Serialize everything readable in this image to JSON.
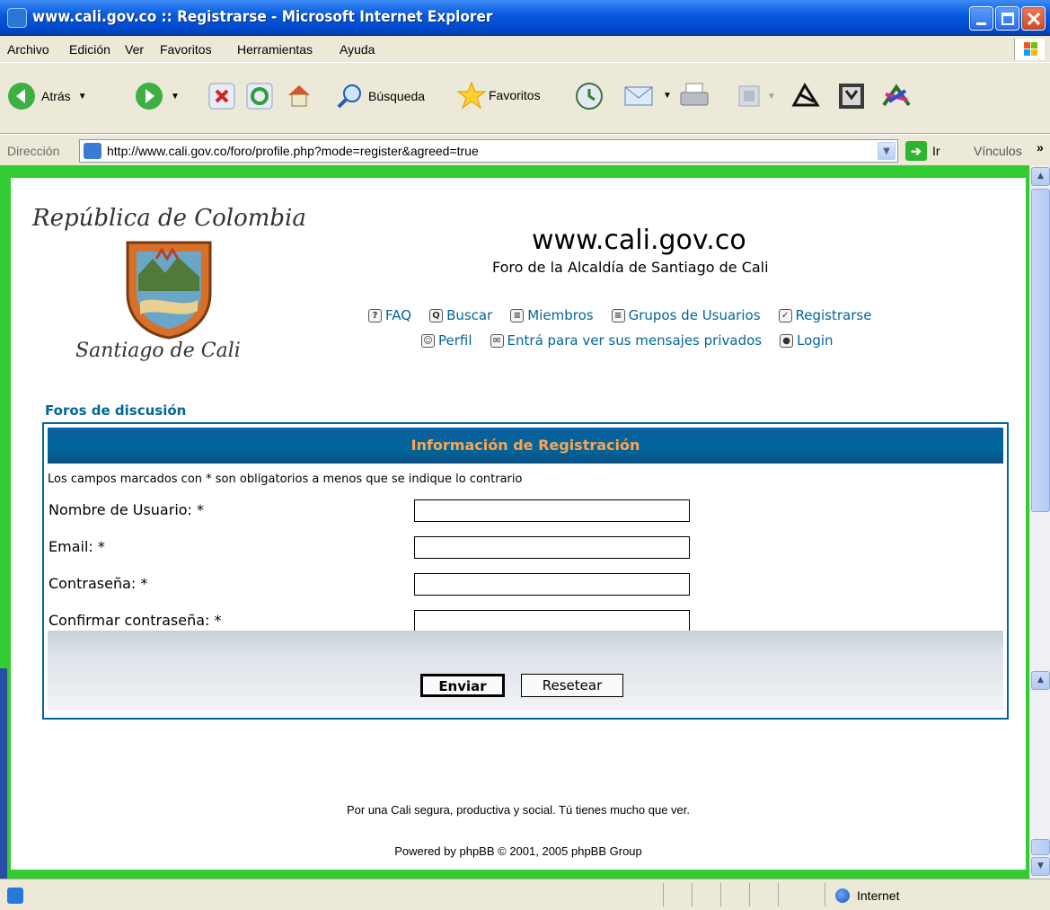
{
  "window": {
    "title": "www.cali.gov.co :: Registrarse - Microsoft Internet Explorer"
  },
  "menu": {
    "items": [
      "Archivo",
      "Edición",
      "Ver",
      "Favoritos",
      "Herramientas",
      "Ayuda"
    ]
  },
  "toolbar": {
    "back_label": "Atrás",
    "search_label": "Búsqueda",
    "favorites_label": "Favoritos"
  },
  "address": {
    "label": "Dirección",
    "url": "http://www.cali.gov.co/foro/profile.php?mode=register&agreed=true",
    "go_label": "Ir",
    "links_label": "Vínculos"
  },
  "page": {
    "logo_top": "República de Colombia",
    "logo_bottom": "Santiago de Cali",
    "site_title": "www.cali.gov.co",
    "site_subtitle": "Foro de la Alcaldía de Santiago de Cali",
    "nav": {
      "faq": "FAQ",
      "buscar": "Buscar",
      "miembros": "Miembros",
      "grupos": "Grupos de Usuarios",
      "registrarse": "Registrarse",
      "perfil": "Perfil",
      "mensajes": "Entrá para ver sus mensajes privados",
      "login": "Login"
    },
    "breadcrumb": "Foros de discusión",
    "form": {
      "header": "Información de Registración",
      "required_note": "Los campos marcados con * son obligatorios a menos que se indique lo contrario",
      "fields": {
        "username_label": "Nombre de Usuario: *",
        "email_label": "Email: *",
        "password_label": "Contraseña: *",
        "confirm_label": "Confirmar contraseña: *"
      },
      "submit_label": "Enviar",
      "reset_label": "Resetear"
    },
    "footer_slogan": "Por una Cali segura, productiva y social. Tú tienes mucho que ver.",
    "footer_powered": "Powered by phpBB © 2001, 2005 phpBB Group"
  },
  "status": {
    "zone": "Internet"
  },
  "colors": {
    "page_border": "#33cc33",
    "link": "#006699",
    "form_header_text": "#ffa34f"
  }
}
